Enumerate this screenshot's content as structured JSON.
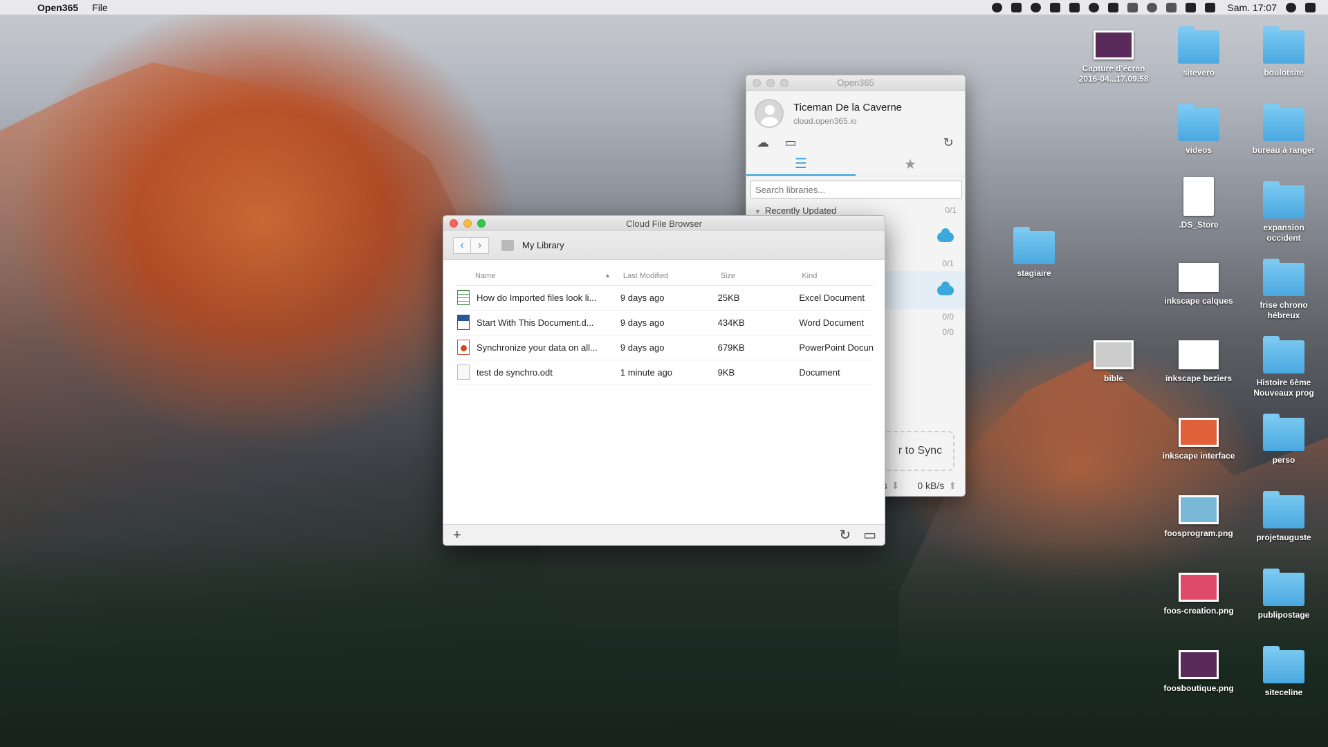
{
  "menubar": {
    "app_name": "Open365",
    "menus": [
      "File"
    ],
    "clock": "Sam. 17:07",
    "tray_icons": [
      "open365-icon",
      "screenshot-icon",
      "cloud-icon",
      "drive-icon",
      "dropbox-icon",
      "cloud-icon",
      "airplay-icon",
      "eject-icon",
      "time-machine-icon",
      "bluetooth-icon",
      "wifi-icon",
      "volume-icon",
      "search-icon",
      "list-icon"
    ]
  },
  "desktop": {
    "items": [
      {
        "label": "Capture d'écran 2016-04...17.09.58",
        "kind": "image"
      },
      {
        "label": "sitevero",
        "kind": "folder"
      },
      {
        "label": "boulotsite",
        "kind": "folder"
      },
      {
        "label": "videos",
        "kind": "folder"
      },
      {
        "label": "bureau à ranger",
        "kind": "folder"
      },
      {
        "label": ".DS_Store",
        "kind": "document"
      },
      {
        "label": "expansion occident",
        "kind": "folder"
      },
      {
        "label": "stagiaire",
        "kind": "folder"
      },
      {
        "label": "inkscape calques",
        "kind": "image"
      },
      {
        "label": "frise chrono hébreux",
        "kind": "folder"
      },
      {
        "label": "bible",
        "kind": "image"
      },
      {
        "label": "inkscape beziers",
        "kind": "image"
      },
      {
        "label": "Histoire 6ème Nouveaux prog",
        "kind": "folder"
      },
      {
        "label": "inkscape interface",
        "kind": "image"
      },
      {
        "label": "perso",
        "kind": "folder"
      },
      {
        "label": "foosprogram.png",
        "kind": "image"
      },
      {
        "label": "projetauguste",
        "kind": "folder"
      },
      {
        "label": "foos-creation.png",
        "kind": "image"
      },
      {
        "label": "publipostage",
        "kind": "folder"
      },
      {
        "label": "foosboutique.png",
        "kind": "image"
      },
      {
        "label": "siteceline",
        "kind": "folder"
      }
    ]
  },
  "open365": {
    "title": "Open365",
    "account_name": "Ticeman De la Caverne",
    "account_server": "cloud.open365.io",
    "search_placeholder": "Search libraries...",
    "section_title": "Recently Updated",
    "section_count": "0/1",
    "counts": [
      "0/1",
      "0/0",
      "0/0"
    ],
    "sync_drop_text": "r to Sync",
    "download_rate_partial": "s",
    "upload_rate": "0 kB/s"
  },
  "cloud_browser": {
    "title": "Cloud File Browser",
    "breadcrumb": "My Library",
    "columns": {
      "name": "Name",
      "modified": "Last Modified",
      "size": "Size",
      "kind": "Kind"
    },
    "files": [
      {
        "name": "How do Imported files look li...",
        "modified": "9 days ago",
        "size": "25KB",
        "kind": "Excel Document",
        "type": "xls"
      },
      {
        "name": "Start With This Document.d...",
        "modified": "9 days ago",
        "size": "434KB",
        "kind": "Word Document",
        "type": "doc"
      },
      {
        "name": "Synchronize your data on all...",
        "modified": "9 days ago",
        "size": "679KB",
        "kind": "PowerPoint Docun",
        "type": "ppt"
      },
      {
        "name": "test de synchro.odt",
        "modified": "1 minute ago",
        "size": "9KB",
        "kind": "Document",
        "type": "odt"
      }
    ]
  },
  "colors": {
    "accent": "#2fa3df",
    "folder": "#5ab6e8"
  }
}
